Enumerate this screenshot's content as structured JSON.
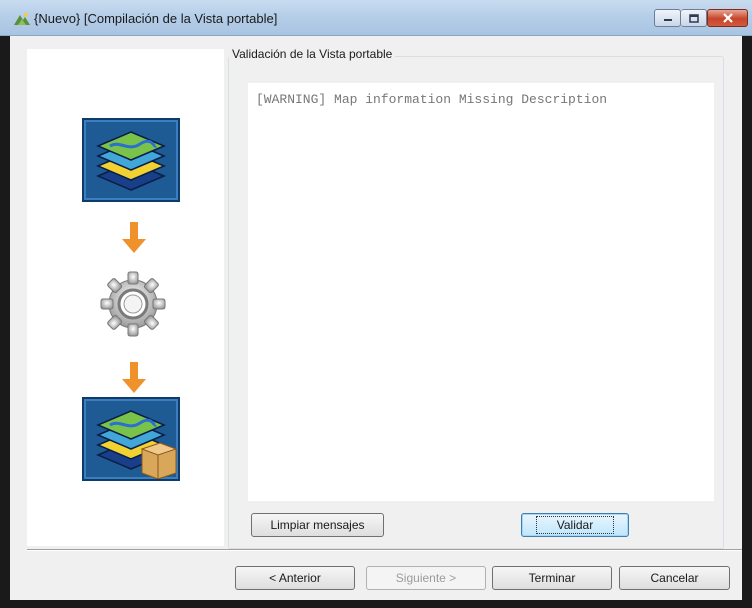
{
  "window": {
    "title": "{Nuevo} [Compilación de la Vista portable]",
    "controls": {
      "minimize": "minimize",
      "maximize": "maximize",
      "close": "close"
    }
  },
  "steps": {
    "icons": [
      "map-layers-icon",
      "arrow-down-icon",
      "gear-icon",
      "arrow-down-icon",
      "map-layers-package-icon"
    ]
  },
  "validation": {
    "group_label": "Validación de la Vista portable",
    "log": "[WARNING] Map information Missing Description",
    "clear_label": "Limpiar mensajes",
    "validate_label": "Validar"
  },
  "nav": {
    "back_label": "< Anterior",
    "next_label": "Siguiente >",
    "finish_label": "Terminar",
    "cancel_label": "Cancelar"
  },
  "colors": {
    "accent_arrow": "#f0922b",
    "map_tile": "#1e5a94",
    "close_button": "#c7452b"
  }
}
